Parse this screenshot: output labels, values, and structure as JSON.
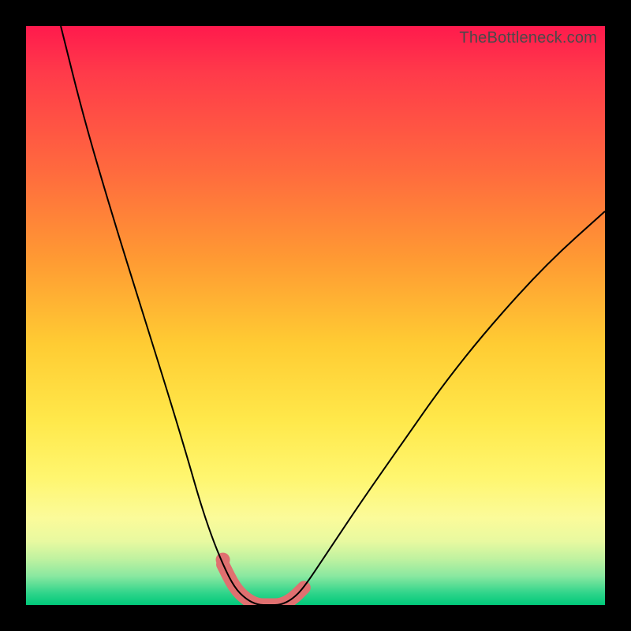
{
  "watermark": "TheBottleneck.com",
  "chart_data": {
    "type": "line",
    "title": "",
    "xlabel": "",
    "ylabel": "",
    "xlim": [
      0,
      100
    ],
    "ylim": [
      0,
      100
    ],
    "grid": false,
    "legend": false,
    "series": [
      {
        "name": "bottleneck-curve",
        "x": [
          6,
          10,
          15,
          20,
          25,
          28,
          30,
          32,
          34,
          36,
          38,
          40,
          42,
          44,
          46,
          48,
          52,
          58,
          65,
          72,
          80,
          90,
          100
        ],
        "values": [
          100,
          84,
          67,
          51,
          35,
          25,
          18,
          12,
          7,
          3,
          1,
          0,
          0,
          0,
          1,
          3,
          9,
          18,
          28,
          38,
          48,
          59,
          68
        ]
      }
    ],
    "highlight": {
      "name": "optimal-range",
      "x": [
        34,
        36,
        38,
        40,
        42,
        44,
        46,
        48
      ],
      "values": [
        7,
        3,
        1,
        0,
        0,
        0,
        1,
        3
      ]
    },
    "background_gradient": {
      "stops": [
        {
          "pos": 0.0,
          "color": "#ff1a4d"
        },
        {
          "pos": 0.4,
          "color": "#ff9933"
        },
        {
          "pos": 0.68,
          "color": "#ffe84a"
        },
        {
          "pos": 0.85,
          "color": "#fbfb9a"
        },
        {
          "pos": 1.0,
          "color": "#00c97a"
        }
      ]
    }
  }
}
